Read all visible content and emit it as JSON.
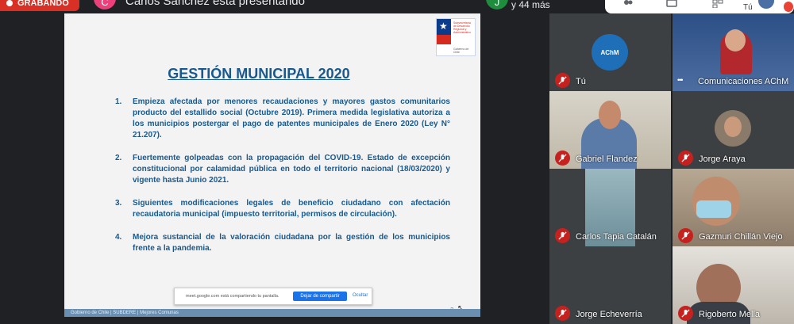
{
  "recording": {
    "label": "GRABANDO"
  },
  "presenter": {
    "initial": "C",
    "status_text": "Carlos Sánchez está presentando"
  },
  "others": {
    "initial": "J",
    "count_text": "y 44 más"
  },
  "top_controls": {
    "self_label": "Tú"
  },
  "slide": {
    "logo_lines": "Subsecretaría de Desarrollo Regional y Administrativo",
    "logo_caption": "Gobierno de Chile",
    "title": "GESTIÓN MUNICIPAL 2020",
    "items": [
      {
        "num": "1.",
        "text": "Empieza afectada por menores recaudaciones y mayores gastos comunitarios producto del estallido social (Octubre 2019). Primera medida legislativa autoriza a los municipios postergar el pago de patentes municipales de Enero 2020 (Ley N° 21.207)."
      },
      {
        "num": "2.",
        "text": "Fuertemente golpeadas con la propagación del COVID-19. Estado de excepción constitucional por calamidad pública en todo el territorio nacional (18/03/2020) y vigente hasta Junio 2021."
      },
      {
        "num": "3.",
        "text": "Siguientes modificaciones legales de beneficio ciudadano con afectación recaudatoria municipal (impuesto territorial, permisos de circulación)."
      },
      {
        "num": "4.",
        "text": "Mejora sustancial de la valoración ciudadana por la gestión de los municipios frente a la pandemia."
      }
    ],
    "share_bar": {
      "message": "meet.google.com está compartiendo tu pantalla.",
      "stop_label": "Dejar de compartir",
      "hide_label": "Ocultar"
    },
    "page_number": "2",
    "footer_text": "Gobierno de Chile | SUBDERE | Mejores Comunas"
  },
  "participants": [
    {
      "name": "Tú",
      "muted": true,
      "avatar_text": "AChM"
    },
    {
      "name": "Comunicaciones AChM",
      "muted": false
    },
    {
      "name": "Gabriel Flandez",
      "muted": true
    },
    {
      "name": "Jorge Araya",
      "muted": true
    },
    {
      "name": "Carlos Tapia Catalán",
      "muted": true
    },
    {
      "name": "Gazmuri Chillán Viejo",
      "muted": true
    },
    {
      "name": "Jorge Echeverría",
      "muted": true
    },
    {
      "name": "Rigoberto Mella",
      "muted": true
    }
  ],
  "colors": {
    "record_red": "#d93025",
    "slide_text": "#17598f",
    "mute_red": "#c5221f",
    "share_blue": "#1a73e8"
  }
}
